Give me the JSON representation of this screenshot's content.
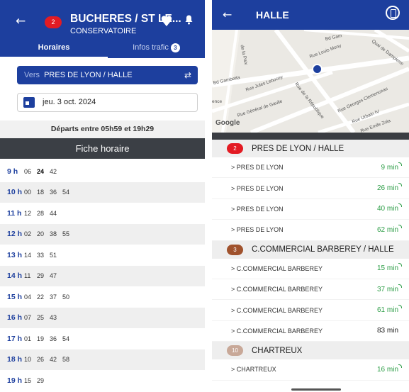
{
  "left": {
    "header": {
      "line_number": "2",
      "line_color": "#e31b23",
      "stop_name": "BUCHERES / ST LE...",
      "stop_sub": "CONSERVATOIRE",
      "favorite_icon": "heart-icon",
      "notification_icon": "bell-icon",
      "back_icon": "arrow-left-icon"
    },
    "tabs": [
      {
        "label": "Horaires",
        "active": true
      },
      {
        "label": "Infos trafic",
        "count": "3",
        "active": false
      }
    ],
    "direction": {
      "prefix": "Vers",
      "value": "PRES DE LYON / HALLE",
      "swap_icon": "swap-arrows-icon"
    },
    "date": {
      "value": "jeu. 3 oct. 2024",
      "icon": "calendar-icon"
    },
    "departs_text": "Départs entre 05h59 et 19h29",
    "fiche_label": "Fiche horaire",
    "hours": [
      {
        "hour": "9 h",
        "minutes": [
          "06",
          "24",
          "42"
        ],
        "bold_index": 1
      },
      {
        "hour": "10 h",
        "minutes": [
          "00",
          "18",
          "36",
          "54"
        ]
      },
      {
        "hour": "11 h",
        "minutes": [
          "12",
          "28",
          "44"
        ]
      },
      {
        "hour": "12 h",
        "minutes": [
          "02",
          "20",
          "38",
          "55"
        ]
      },
      {
        "hour": "13 h",
        "minutes": [
          "14",
          "33",
          "51"
        ]
      },
      {
        "hour": "14 h",
        "minutes": [
          "11",
          "29",
          "47"
        ]
      },
      {
        "hour": "15 h",
        "minutes": [
          "04",
          "22",
          "37",
          "50"
        ]
      },
      {
        "hour": "16 h",
        "minutes": [
          "07",
          "25",
          "43"
        ]
      },
      {
        "hour": "17 h",
        "minutes": [
          "01",
          "19",
          "36",
          "54"
        ]
      },
      {
        "hour": "18 h",
        "minutes": [
          "10",
          "26",
          "42",
          "58"
        ]
      },
      {
        "hour": "19 h",
        "minutes": [
          "15",
          "29"
        ]
      }
    ]
  },
  "right": {
    "header": {
      "title": "HALLE",
      "back_icon": "arrow-left-icon",
      "timer_icon": "hourglass-icon"
    },
    "map": {
      "streets": [
        "Bd Gambetta",
        "Rue Jules Lebocey",
        "Rue Général de Gaulle",
        "Rue de la République",
        "Rue Georges Clemenceau",
        "Rue Urbain IV",
        "Rue Emile Zola",
        "Rue Louis Mony",
        "Quai de Dampierre",
        "Bd Gam",
        "de la Paix",
        "ence"
      ],
      "attribution": "Google"
    },
    "groups": [
      {
        "line": "2",
        "color": "#e31b23",
        "name": "PRES DE LYON / HALLE",
        "rows": [
          {
            "dest": "> PRES DE LYON",
            "time": "9 min",
            "realtime": true
          },
          {
            "dest": "> PRES DE LYON",
            "time": "26 min",
            "realtime": true
          },
          {
            "dest": "> PRES DE LYON",
            "time": "40 min",
            "realtime": true
          },
          {
            "dest": "> PRES DE LYON",
            "time": "62 min",
            "realtime": true
          }
        ]
      },
      {
        "line": "3",
        "color": "#a0522d",
        "name": "C.COMMERCIAL BARBEREY / HALLE",
        "rows": [
          {
            "dest": "> C.COMMERCIAL BARBEREY",
            "time": "15 min",
            "realtime": true
          },
          {
            "dest": "> C.COMMERCIAL BARBEREY",
            "time": "37 min",
            "realtime": true
          },
          {
            "dest": "> C.COMMERCIAL BARBEREY",
            "time": "61 min",
            "realtime": true
          },
          {
            "dest": "> C.COMMERCIAL BARBEREY",
            "time": "83 min",
            "realtime": false
          }
        ]
      },
      {
        "line": "10",
        "color": "#c8a898",
        "name": "CHARTREUX",
        "rows": [
          {
            "dest": "> CHARTREUX",
            "time": "16 min",
            "realtime": true
          }
        ]
      }
    ]
  }
}
